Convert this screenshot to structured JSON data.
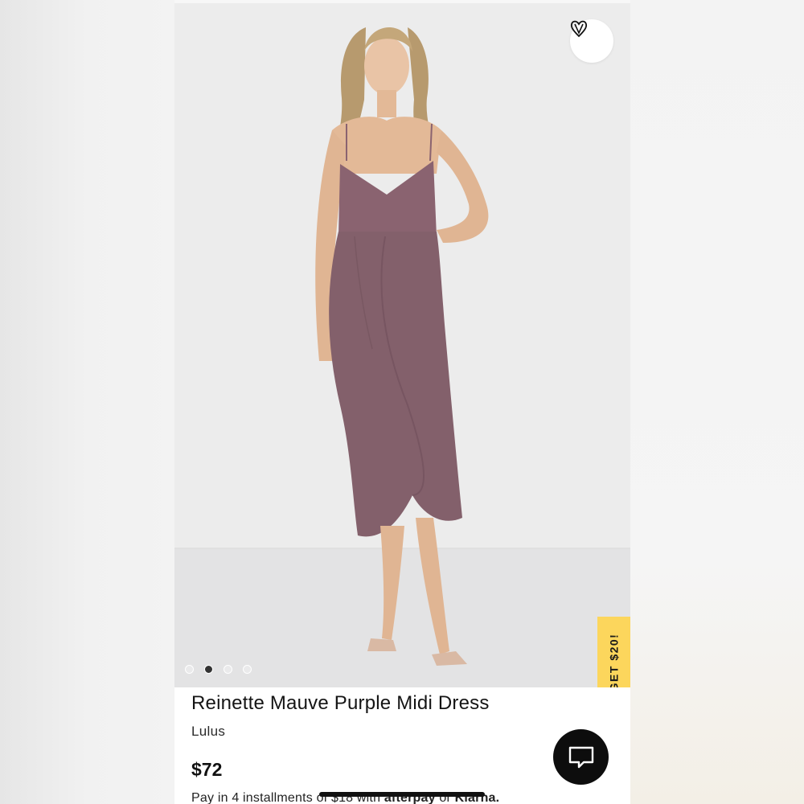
{
  "product": {
    "title": "Reinette Mauve Purple Midi Dress",
    "brand": "Lulus",
    "price": "$72",
    "installments": {
      "prefix": "Pay in 4 installments of $18 with",
      "afterpay": "afterpay",
      "or": "or",
      "klarna": "Klarna."
    }
  },
  "gallery": {
    "image_count": 4,
    "active_index": 1
  },
  "promo": {
    "label": "GET $20!"
  },
  "icons": {
    "wishlist": "heart-v-icon",
    "chat": "chat-bubble-icon"
  },
  "colors": {
    "dress": "#8a6370",
    "promo_tab": "#fcd65c",
    "chat_button": "#0d0d0d",
    "backdrop": "#ebebeb"
  }
}
